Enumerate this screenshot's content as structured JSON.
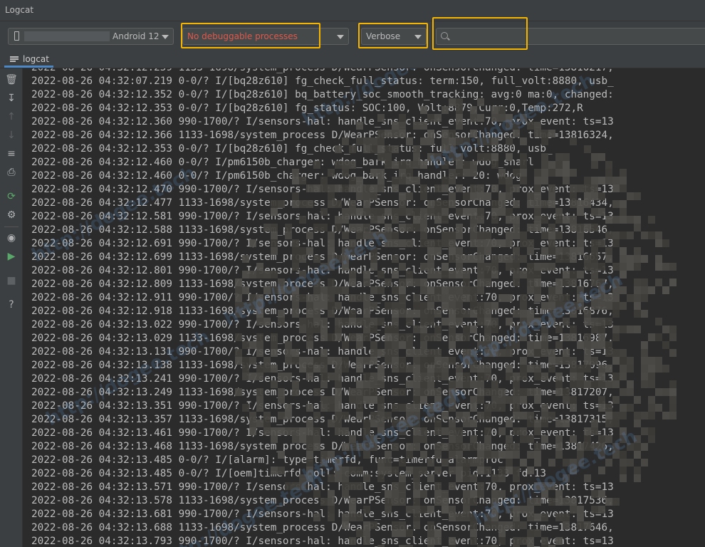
{
  "window": {
    "title": "Logcat"
  },
  "toolbar": {
    "device_label": "Android 12",
    "process_label": "No debuggable processes",
    "level_label": "Verbose",
    "search_value": ""
  },
  "tab": {
    "label": "logcat"
  },
  "log_lines": [
    "2022-08-26 04:32:12.259 1133-1698/system_process D/WearPSensor: onSensorChanged: time=13816217,",
    "2022-08-26 04:32:07.219 0-0/? I/[bq28z610] fg_check_full_status: term:150, full_volt:8880, usb_",
    "2022-08-26 04:32:12.352 0-0/? I/[bq28z610] bq_battery_soc_smooth_tracking: avg:0 ma:0, changed:",
    "2022-08-26 04:32:12.353 0-0/? I/[bq28z610] fg_status: SOC:100, Volt:8879,Curr:0,Temp:272,R",
    "2022-08-26 04:32:12.360 990-1700/? I/sensors-hal: handle_sns_client_event:70, prox_event: ts=13",
    "2022-08-26 04:32:12.366 1133-1698/system_process D/WearPSensor: onSensorChanged: time=13816324,",
    "2022-08-26 04:32:12.353 0-0/? I/[bq28z610] fg_check_full_status: full_volt:8880, usb_",
    "2022-08-26 04:32:12.460 0-0/? I/pm6150b_charger: wdog_bark_irq_handler: wdog_snarl",
    "2022-08-26 04:32:12.460 0-0/? I/pm6150b_charger: wdog_bark_irq_handler: 20: wdog",
    "2022-08-26 04:32:12.470 990-1700/? I/sensors-hal: handle_sns_client_event:70, prox_event: ts=13",
    "2022-08-26 04:32:12.477 1133-1698/system_process D/WearPSensor: onSensorChanged: time=13816434,",
    "2022-08-26 04:32:12.581 990-1700/? I/sensors-hal: handle_sns_client_event:70, prox_event: ts=13",
    "2022-08-26 04:32:12.588 1133-1698/system_process D/WearPSensor: onSensorChanged: time=13816546,",
    "2022-08-26 04:32:12.691 990-1700/? I/sensors-hal: handle_sns_client_event:70, prox_event: ts=13",
    "2022-08-26 04:32:12.699 1133-1698/system_process D/WearPSensor: onSensorChanged: time=13816657,",
    "2022-08-26 04:32:12.801 990-1700/? I/sensors-hal: handle_sns_client_event:70, prox_event: ts=13",
    "2022-08-26 04:32:12.809 1133-1698/system_process D/WearPSensor: onSensorChanged: time=13816767,",
    "2022-08-26 04:32:12.911 990-1700/? I/sensors-hal: handle_sns_client_event:70, prox_event: ts=13",
    "2022-08-26 04:32:12.918 1133-1698/system_process D/WearPSensor: onSensorChanged: time=13816876,",
    "2022-08-26 04:32:13.022 990-1700/? I/sensors-hal: handle_sns_client_event:70, prox_event: ts=13",
    "2022-08-26 04:32:13.029 1133-1698/system_process D/WearPSensor: onSensorChanged: time=13816987,",
    "2022-08-26 04:32:13.131 990-1700/? I/sensors-hal: handle_sns_client_event:70, prox_event: ts=13",
    "2022-08-26 04:32:13.138 1133-1698/system_process D/WearPSensor: onSensorChanged: time=13817096,",
    "2022-08-26 04:32:13.241 990-1700/? I/sensors-hal: handle_sns_client_event:70, prox_event: ts=13",
    "2022-08-26 04:32:13.249 1133-1698/system_process D/WearPSensor: onSensorChanged: time=13817207,",
    "2022-08-26 04:32:13.351 990-1700/? I/sensors-hal: handle_sns_client_event:70, prox_event: ts=13",
    "2022-08-26 04:32:13.357 1133-1698/system_process D/WearPSensor: onSensorChanged: time=13817315,",
    "2022-08-26 04:32:13.461 990-1700/? I/sensors-hal: handle_sns_client_event:70, prox_event: ts=13",
    "2022-08-26 04:32:13.468 1133-1698/system_process D/WearPSensor: onSensorChanged: time=13817426,",
    "2022-08-26 04:32:13.485 0-0/? I/[alarm]: type=timerfd, func=timerfd_alarmproc",
    "2022-08-26 04:32:13.485 0-0/? I/[oem]timerfd_poll: comm:system_server pid:1133 fd:13",
    "2022-08-26 04:32:13.571 990-1700/? I/sensors-hal: handle_sns_client_event:70, prox_event: ts=13",
    "2022-08-26 04:32:13.578 1133-1698/system_process D/WearPSensor: onSensorChanged: time=13817536,",
    "2022-08-26 04:32:13.681 990-1700/? I/sensors-hal: handle_sns_client_event:70, prox_event: ts=13",
    "2022-08-26 04:32:13.688 1133-1698/system_process D/WearPSensor: onSensorChanged: time=13817646,",
    "2022-08-26 04:32:13.793 990-1700/? I/sensors-hal: handle_sns_client_event:70, prox_event: ts=13"
  ],
  "watermark_text": "http://dogee.tech",
  "sidebar_icons": [
    "trash-icon",
    "scroll-end-icon",
    "up-arrow-icon",
    "down-arrow-icon",
    "soft-wrap-icon",
    "print-icon",
    "restart-icon",
    "gear-icon",
    "camera-icon",
    "screen-record-icon",
    "stop-icon",
    "help-icon"
  ],
  "colors": {
    "highlight": "#f5b400",
    "process_text": "#e0584a",
    "background": "#2b2b2b"
  }
}
